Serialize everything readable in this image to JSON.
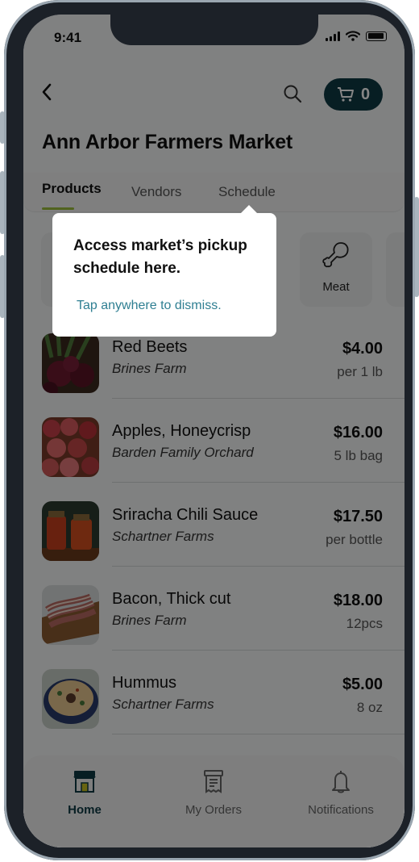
{
  "status": {
    "time": "9:41"
  },
  "header": {
    "cart_count": "0",
    "title": "Ann Arbor Farmers Market"
  },
  "tabs": [
    {
      "label": "Products",
      "active": true
    },
    {
      "label": "Vendors",
      "active": false
    },
    {
      "label": "Schedule",
      "active": false
    }
  ],
  "categories": [
    {
      "label": "Meat",
      "icon": "drumstick-icon"
    }
  ],
  "products": [
    {
      "name": "Red Beets",
      "vendor": "Brines Farm",
      "price": "$4.00",
      "unit": "per 1 lb"
    },
    {
      "name": "Apples, Honeycrisp",
      "vendor": "Barden Family Orchard",
      "price": "$16.00",
      "unit": "5 lb bag"
    },
    {
      "name": "Sriracha Chili Sauce",
      "vendor": "Schartner Farms",
      "price": "$17.50",
      "unit": "per bottle"
    },
    {
      "name": "Bacon, Thick cut",
      "vendor": "Brines Farm",
      "price": "$18.00",
      "unit": "12pcs"
    },
    {
      "name": "Hummus",
      "vendor": "Schartner Farms",
      "price": "$5.00",
      "unit": "8 oz"
    }
  ],
  "tooltip": {
    "message": "Access market’s pickup schedule here.",
    "dismiss": "Tap anywhere to dismiss."
  },
  "bottom_nav": [
    {
      "label": "Home",
      "icon": "store-icon",
      "active": true
    },
    {
      "label": "My Orders",
      "icon": "receipt-icon",
      "active": false
    },
    {
      "label": "Notifications",
      "icon": "bell-icon",
      "active": false
    }
  ],
  "colors": {
    "accent": "#0e3a44",
    "tab_underline": "#9bbf3c",
    "link": "#2f7f92"
  }
}
